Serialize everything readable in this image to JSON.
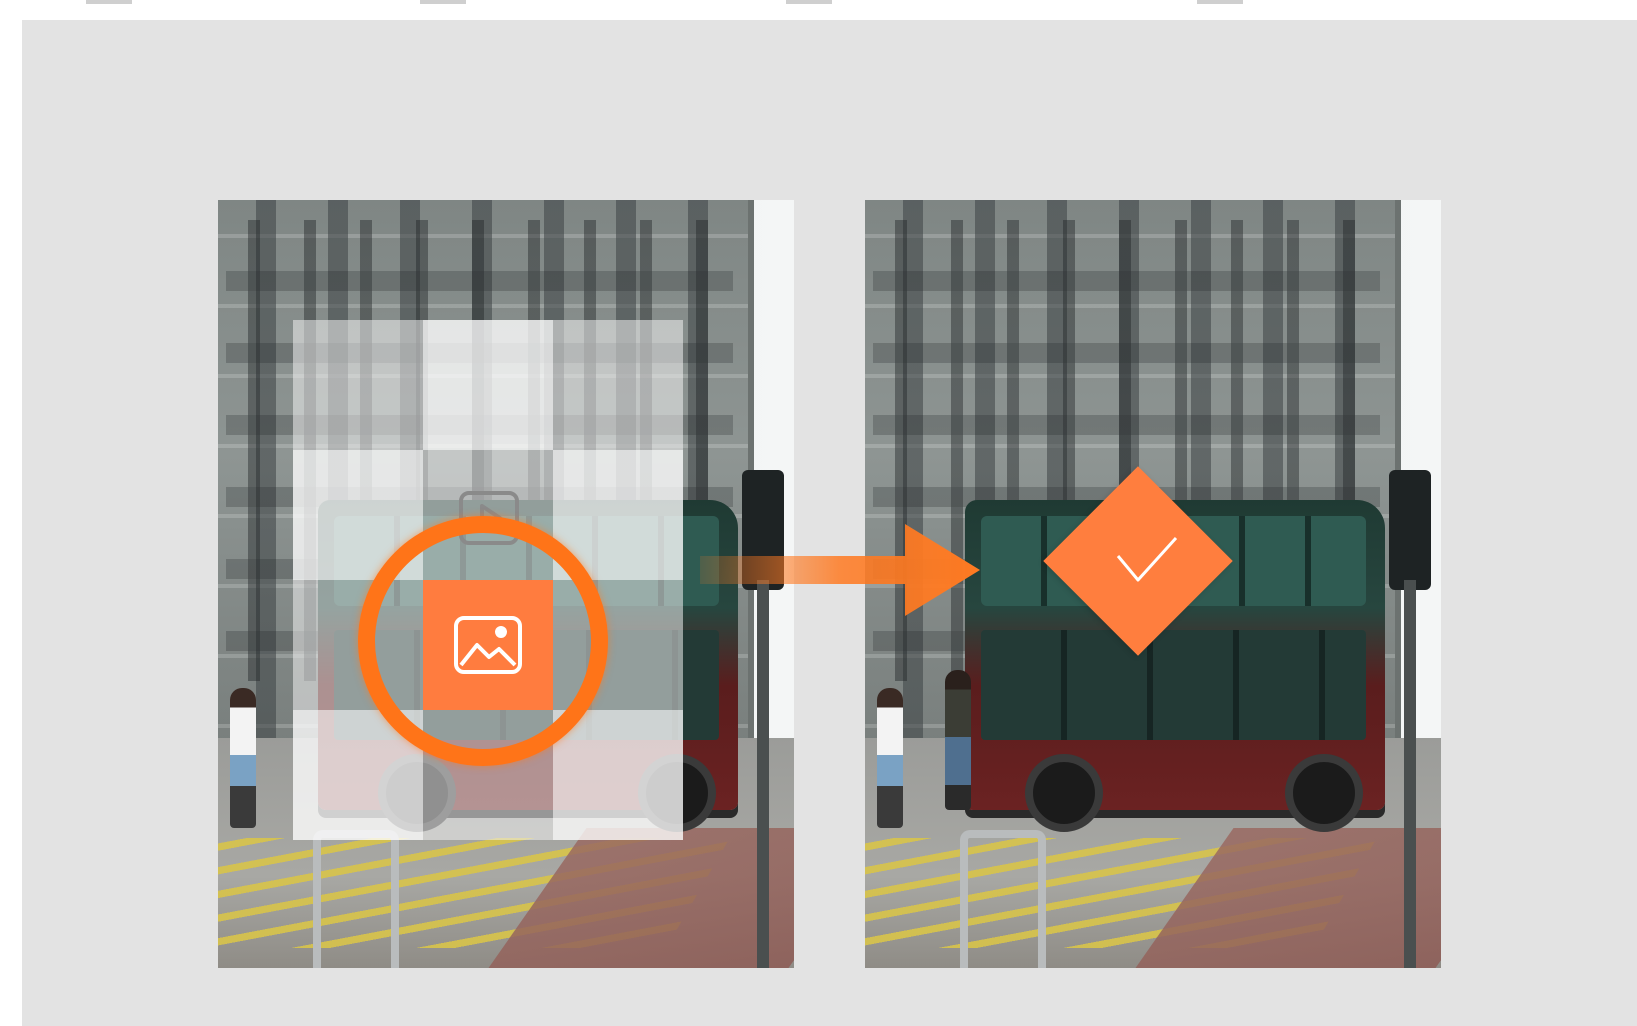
{
  "colors": {
    "accent": "#ff7c3f",
    "ring": "#ff7418",
    "panel_background": "#e3e3e3"
  },
  "icons": {
    "image": "image-icon",
    "video": "video-icon",
    "arrow": "arrow-right-icon",
    "check": "check-icon"
  }
}
